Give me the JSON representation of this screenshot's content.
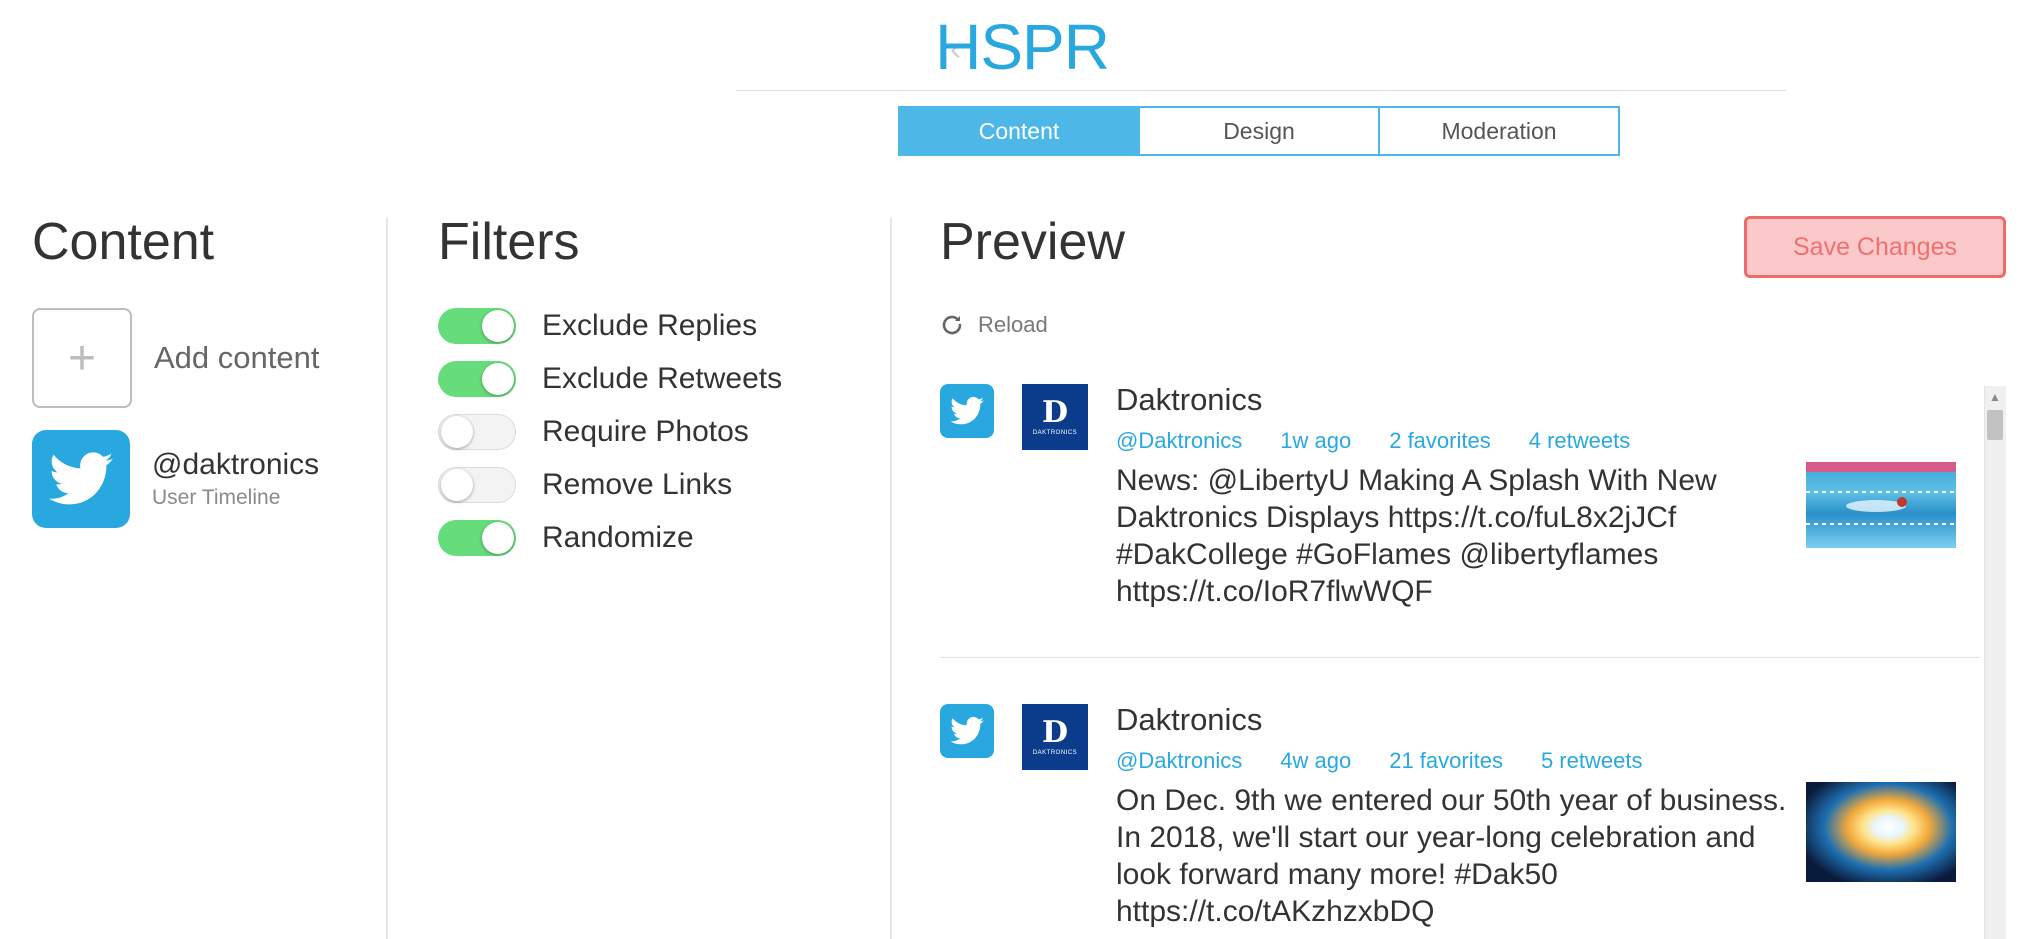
{
  "header": {
    "back_glyph": "‹",
    "title": "HSPR",
    "tabs": [
      {
        "label": "Content",
        "active": true
      },
      {
        "label": "Design",
        "active": false
      },
      {
        "label": "Moderation",
        "active": false
      }
    ]
  },
  "content_col": {
    "title": "Content",
    "add_icon": "+",
    "add_label": "Add content",
    "source": {
      "name": "@daktronics",
      "type": "User Timeline",
      "icon": "twitter-bird-icon"
    }
  },
  "filters_col": {
    "title": "Filters",
    "items": [
      {
        "label": "Exclude Replies",
        "on": true
      },
      {
        "label": "Exclude Retweets",
        "on": true
      },
      {
        "label": "Require Photos",
        "on": false
      },
      {
        "label": "Remove Links",
        "on": false
      },
      {
        "label": "Randomize",
        "on": true
      }
    ]
  },
  "preview_col": {
    "title": "Preview",
    "save_label": "Save Changes",
    "reload_label": "Reload",
    "posts": [
      {
        "author": "Daktronics",
        "handle": "@Daktronics",
        "age": "1w ago",
        "favorites": "2 favorites",
        "retweets": "4 retweets",
        "text": "News: @LibertyU Making A Splash With New Daktronics Displays https://t.co/fuL8x2jJCf #DakCollege #GoFlames @libertyflames https://t.co/IoR7flwWQF"
      },
      {
        "author": "Daktronics",
        "handle": "@Daktronics",
        "age": "4w ago",
        "favorites": "21 favorites",
        "retweets": "5 retweets",
        "text": "On Dec. 9th we entered our 50th year of business. In 2018, we'll start our year-long celebration and look forward many more! #Dak50 https://t.co/tAKzhzxbDQ"
      }
    ],
    "avatar_text": "DAKTRONICS"
  },
  "colors": {
    "accent": "#29a8e0",
    "toggle_on": "#66dc7a",
    "save_border": "#ef6a6a",
    "save_bg": "#fbc9c9"
  }
}
